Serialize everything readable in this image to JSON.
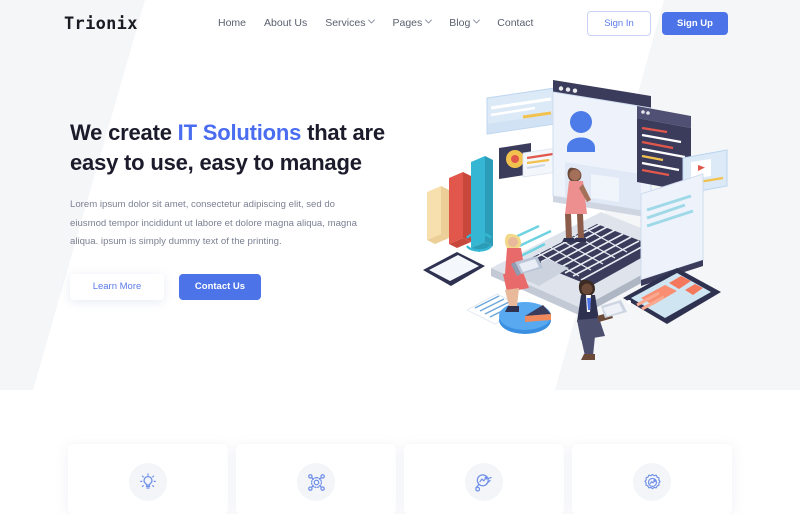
{
  "brand": {
    "name": "Trionix"
  },
  "header": {
    "nav": [
      {
        "label": "Home",
        "has_caret": false,
        "name": "nav-home"
      },
      {
        "label": "About Us",
        "has_caret": false,
        "name": "nav-about-us"
      },
      {
        "label": "Services",
        "has_caret": true,
        "name": "nav-services"
      },
      {
        "label": "Pages",
        "has_caret": true,
        "name": "nav-pages"
      },
      {
        "label": "Blog",
        "has_caret": true,
        "name": "nav-blog"
      },
      {
        "label": "Contact",
        "has_caret": false,
        "name": "nav-contact"
      }
    ],
    "sign_in_label": "Sign In",
    "sign_up_label": "Sign Up"
  },
  "hero": {
    "title_part1": "We create ",
    "title_accent": "IT Solutions",
    "title_part2": " that are",
    "title_line2": "easy to use, easy to manage",
    "paragraph": "Lorem ipsum dolor sit amet, consectetur adipiscing elit, sed do eiusmod tempor incididunt ut labore et dolore magna aliqua, magna aliqua. ipsum is simply dummy text of the printing.",
    "btn_learn_label": "Learn More",
    "btn_contact_label": "Contact Us",
    "illustration_name": "isometric-team-devices-illustration"
  },
  "features": [
    {
      "icon": "lightbulb-icon",
      "name": "feature-card-1"
    },
    {
      "icon": "network-hub-icon",
      "name": "feature-card-2"
    },
    {
      "icon": "magnifier-chart-icon",
      "name": "feature-card-3"
    },
    {
      "icon": "gear-chart-icon",
      "name": "feature-card-4"
    }
  ],
  "colors": {
    "accent_blue": "#4d73e8",
    "link_blue": "#5b7ce8",
    "heading_dark": "#1b1b2b",
    "body_grey": "#7c8193",
    "panel_grey": "#f5f6f8",
    "illus_navy": "#3b3b5c",
    "illus_red": "#e2574c",
    "illus_cyan": "#35b7d4",
    "illus_sand": "#f6d9a0",
    "illus_coral": "#f98e72"
  }
}
